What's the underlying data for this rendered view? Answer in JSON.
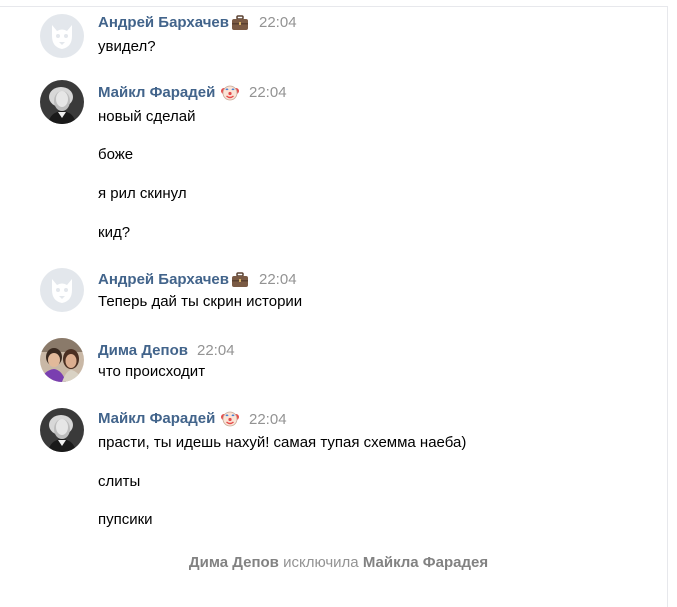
{
  "messages": [
    {
      "author": "Андрей Бархачев",
      "author_badge": "briefcase-emoji",
      "time": "22:04",
      "avatar": "vk-default-avatar",
      "lines": [
        "увидел?"
      ]
    },
    {
      "author": "Майкл Фарадей",
      "author_badge": "clown-face-emoji",
      "time": "22:04",
      "avatar": "faraday-portrait-avatar",
      "lines": [
        "новый сделай",
        "боже",
        "я рил скинул",
        "кид?"
      ]
    },
    {
      "author": "Андрей Бархачев",
      "author_badge": "briefcase-emoji",
      "time": "22:04",
      "avatar": "vk-default-avatar",
      "lines": [
        "Теперь дай ты скрин истории"
      ]
    },
    {
      "author": "Дима Депов",
      "author_badge": "",
      "time": "22:04",
      "avatar": "dima-photo-avatar",
      "lines": [
        "что происходит"
      ]
    },
    {
      "author": "Майкл Фарадей",
      "author_badge": "clown-face-emoji",
      "time": "22:04",
      "avatar": "faraday-portrait-avatar",
      "lines": [
        "прасти, ты идешь нахуй! самая тупая схемма наеба)",
        "слиты",
        "пупсики"
      ]
    }
  ],
  "service_message": {
    "actor": "Дима Депов",
    "action": "исключила",
    "target": "Майкла Фарадея"
  },
  "colors": {
    "author_name": "#42648b",
    "timestamp": "#939393",
    "service_text": "#939393",
    "default_avatar_bg": "#e3e7ec",
    "default_avatar_fg": "#ffffff"
  }
}
